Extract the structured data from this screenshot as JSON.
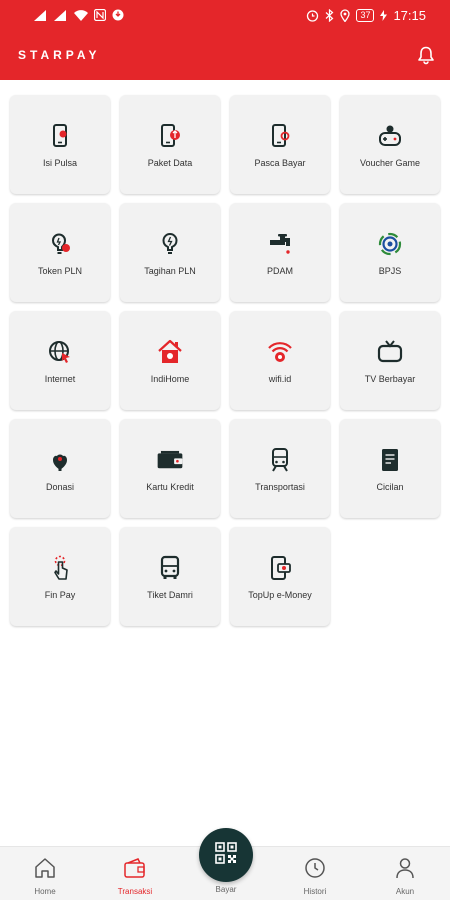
{
  "status_bar": {
    "time": "17:15",
    "battery": "37"
  },
  "app_bar": {
    "brand": "STARPAY"
  },
  "services": [
    {
      "label": "Isi Pulsa",
      "icon": "phone-icon"
    },
    {
      "label": "Paket Data",
      "icon": "phone-data-icon"
    },
    {
      "label": "Pasca Bayar",
      "icon": "phone-postpaid-icon"
    },
    {
      "label": "Voucher Game",
      "icon": "game-controller-icon"
    },
    {
      "label": "Token PLN",
      "icon": "bulb-icon"
    },
    {
      "label": "Tagihan PLN",
      "icon": "bulb-bill-icon"
    },
    {
      "label": "PDAM",
      "icon": "faucet-icon"
    },
    {
      "label": "BPJS",
      "icon": "bpjs-icon"
    },
    {
      "label": "Internet",
      "icon": "globe-icon"
    },
    {
      "label": "IndiHome",
      "icon": "home-icon"
    },
    {
      "label": "wifi.id",
      "icon": "wifi-icon"
    },
    {
      "label": "TV Berbayar",
      "icon": "tv-icon"
    },
    {
      "label": "Donasi",
      "icon": "donation-icon"
    },
    {
      "label": "Kartu Kredit",
      "icon": "wallet-icon"
    },
    {
      "label": "Transportasi",
      "icon": "train-icon"
    },
    {
      "label": "Cicilan",
      "icon": "document-icon"
    },
    {
      "label": "Fin Pay",
      "icon": "touch-icon"
    },
    {
      "label": "Tiket Damri",
      "icon": "bus-icon"
    },
    {
      "label": "TopUp e-Money",
      "icon": "emoney-icon"
    }
  ],
  "bottom_nav": {
    "home": "Home",
    "transaksi": "Transaksi",
    "bayar": "Bayar",
    "histori": "Histori",
    "akun": "Akun"
  },
  "colors": {
    "brand": "#e4262a",
    "dark": "#173535",
    "tile": "#f2f2f2"
  }
}
